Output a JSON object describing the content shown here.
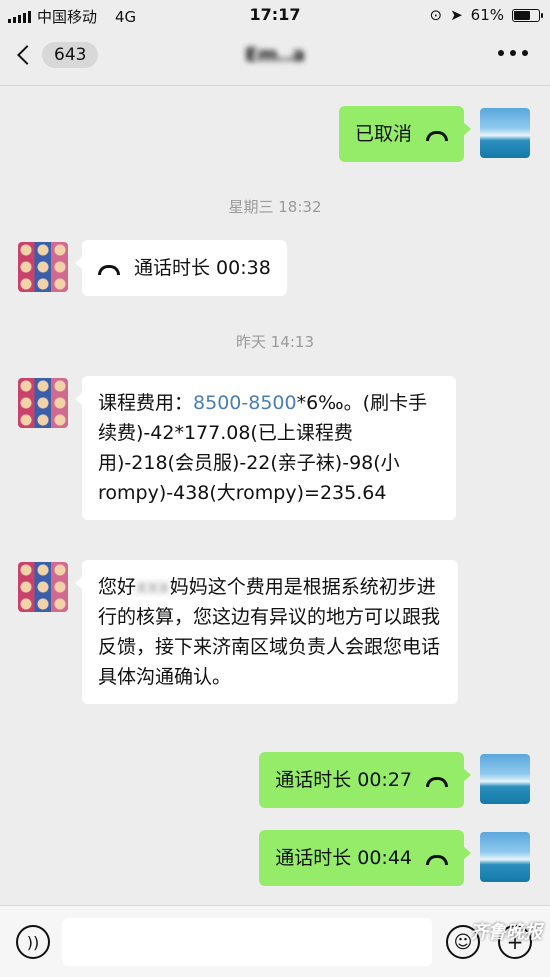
{
  "status_bar": {
    "carrier": "中国移动",
    "network": "4G",
    "time": "17:17",
    "battery_text": "61%",
    "battery_level": 0.61
  },
  "nav": {
    "back_icon": "chevron-left-icon",
    "unread_count": "643",
    "title": "Em..a",
    "more_icon": "more-dots-icon"
  },
  "messages": {
    "m1": {
      "text": "已取消",
      "icon": "handset-icon"
    },
    "sep1": "星期三 18:32",
    "m2": {
      "text": "通话时长 00:38",
      "icon": "handset-icon"
    },
    "sep2": "昨天 14:13",
    "m3": {
      "prefix": "课程费用：",
      "link": "8500-8500",
      "rest": "*6‰。(刷卡手续费)-42*177.08(已上课程费用)-218(会员服)-22(亲子袜)-98(小rompy)-438(大rompy)=235.64"
    },
    "m4": {
      "prefix": "您好",
      "blurred": "xxx",
      "rest": "妈妈这个费用是根据系统初步进行的核算，您这边有异议的地方可以跟我反馈，接下来济南区域负责人会跟您电话具体沟通确认。"
    },
    "m5": {
      "text": "通话时长 00:27",
      "icon": "handset-icon"
    },
    "m6": {
      "text": "通话时长 00:44",
      "icon": "handset-icon"
    }
  },
  "input_bar": {
    "voice_icon": "voice-icon",
    "emoji_icon": "emoji-icon",
    "plus_icon": "plus-icon"
  },
  "watermark": "齐鲁晚报"
}
